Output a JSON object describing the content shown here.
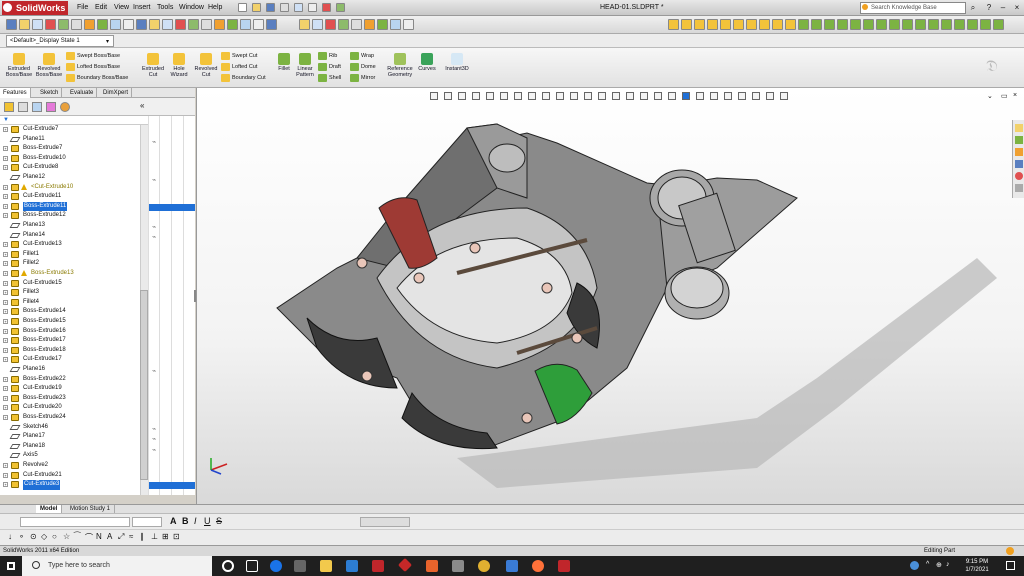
{
  "app": {
    "name": "SolidWorks",
    "document_title": "HEAD-01.SLDPRT *"
  },
  "menu": [
    "File",
    "Edit",
    "View",
    "Insert",
    "Tools",
    "Window",
    "Help"
  ],
  "search": {
    "placeholder": "Search Knowledge Base"
  },
  "configuration": {
    "value": "<Default>_Display State 1"
  },
  "command_manager": {
    "features": [
      {
        "name": "extruded-boss",
        "label": "Extruded Boss/Base"
      },
      {
        "name": "revolved-boss",
        "label": "Revolved Boss/Base"
      },
      {
        "name": "extruded-cut",
        "label": "Extruded Cut"
      },
      {
        "name": "hole-wizard",
        "label": "Hole Wizard"
      },
      {
        "name": "revolved-cut",
        "label": "Revolved Cut"
      },
      {
        "name": "fillet",
        "label": "Fillet"
      },
      {
        "name": "linear-pattern",
        "label": "Linear Pattern"
      },
      {
        "name": "reference-geometry",
        "label": "Reference Geometry"
      },
      {
        "name": "curves",
        "label": "Curves"
      },
      {
        "name": "instant3d",
        "label": "Instant3D"
      }
    ],
    "stacked": {
      "boss_col": [
        "Swept Boss/Base",
        "Lofted Boss/Base",
        "Boundary Boss/Base"
      ],
      "cut_col": [
        "Swept Cut",
        "Lofted Cut",
        "Boundary Cut"
      ],
      "rib_col": [
        "Rib",
        "Draft",
        "Shell"
      ],
      "wrap_col": [
        "Wrap",
        "Dome",
        "Mirror"
      ]
    }
  },
  "panel_tabs": [
    "Features",
    "Sketch",
    "Evaluate",
    "DimXpert"
  ],
  "tree": [
    {
      "label": "Cut-Extrude7",
      "type": "feature"
    },
    {
      "label": "Plane11",
      "type": "plane"
    },
    {
      "label": "Boss-Extrude7",
      "type": "feature"
    },
    {
      "label": "Boss-Extrude10",
      "type": "feature"
    },
    {
      "label": "Cut-Extrude8",
      "type": "feature"
    },
    {
      "label": "Plane12",
      "type": "plane"
    },
    {
      "label": "<Cut-Extrude10",
      "type": "warning"
    },
    {
      "label": "Cut-Extrude11",
      "type": "feature"
    },
    {
      "label": "Boss-Extrude11",
      "type": "selected"
    },
    {
      "label": "Boss-Extrude12",
      "type": "feature"
    },
    {
      "label": "Plane13",
      "type": "plane"
    },
    {
      "label": "Plane14",
      "type": "plane"
    },
    {
      "label": "Cut-Extrude13",
      "type": "feature"
    },
    {
      "label": "Fillet1",
      "type": "feature"
    },
    {
      "label": "Fillet2",
      "type": "feature"
    },
    {
      "label": "Boss-Extrude13",
      "type": "warning"
    },
    {
      "label": "Cut-Extrude15",
      "type": "feature"
    },
    {
      "label": "Fillet3",
      "type": "feature"
    },
    {
      "label": "Fillet4",
      "type": "feature"
    },
    {
      "label": "Boss-Extrude14",
      "type": "feature"
    },
    {
      "label": "Boss-Extrude15",
      "type": "feature"
    },
    {
      "label": "Boss-Extrude16",
      "type": "feature"
    },
    {
      "label": "Boss-Extrude17",
      "type": "feature"
    },
    {
      "label": "Boss-Extrude18",
      "type": "feature"
    },
    {
      "label": "Cut-Extrude17",
      "type": "feature"
    },
    {
      "label": "Plane16",
      "type": "plane"
    },
    {
      "label": "Boss-Extrude22",
      "type": "feature"
    },
    {
      "label": "Cut-Extrude19",
      "type": "feature"
    },
    {
      "label": "Boss-Extrude23",
      "type": "feature"
    },
    {
      "label": "Cut-Extrude20",
      "type": "feature"
    },
    {
      "label": "Boss-Extrude24",
      "type": "feature"
    },
    {
      "label": "Sketch46",
      "type": "sketch"
    },
    {
      "label": "Plane17",
      "type": "plane"
    },
    {
      "label": "Plane18",
      "type": "plane"
    },
    {
      "label": "Axis5",
      "type": "axis"
    },
    {
      "label": "Revolve2",
      "type": "feature"
    },
    {
      "label": "Cut-Extrude21",
      "type": "feature"
    },
    {
      "label": "Cut-Extrude3",
      "type": "selected"
    }
  ],
  "bottom_tabs": [
    "Model",
    "Motion Study 1"
  ],
  "status": {
    "edition": "SolidWorks 2011 x64 Edition",
    "mode": "Editing Part"
  },
  "taskbar": {
    "search_placeholder": "Type here to search",
    "time": "9:15 PM",
    "date": "1/7/2021"
  },
  "colors": {
    "brand": "#c0262b",
    "selection": "#1f6fd6",
    "face_red": "#9e3a34",
    "face_green": "#2e9e3a"
  }
}
